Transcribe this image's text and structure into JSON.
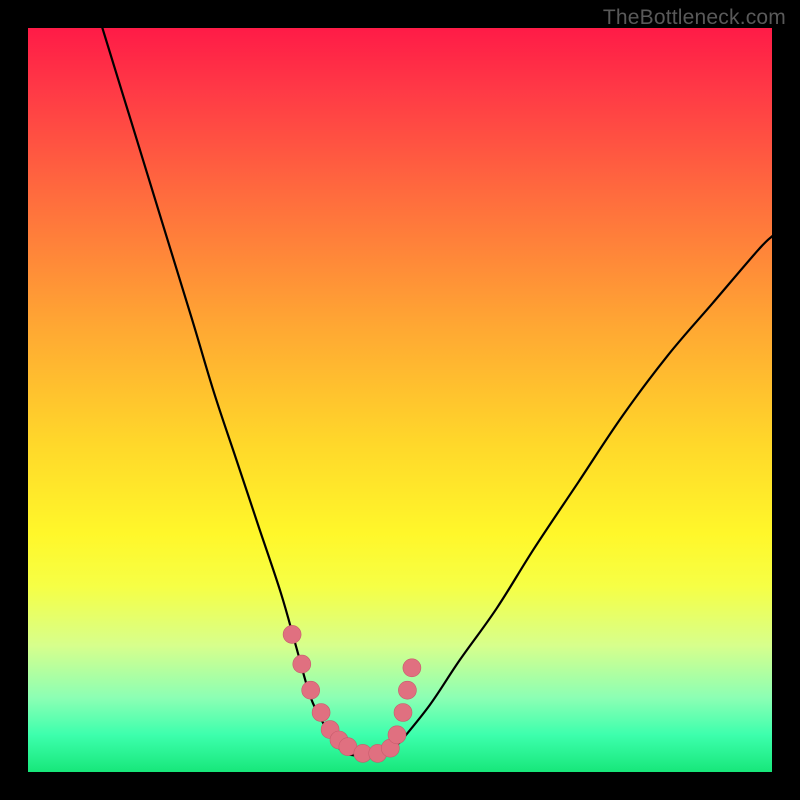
{
  "branding": "TheBottleneck.com",
  "colors": {
    "frame": "#000000",
    "gradient_top": "#ff1b47",
    "gradient_bottom": "#17e77a",
    "curve": "#000000",
    "marker": "#e07080"
  },
  "chart_data": {
    "type": "line",
    "title": "",
    "xlabel": "",
    "ylabel": "",
    "xlim": [
      0,
      100
    ],
    "ylim": [
      0,
      100
    ],
    "grid": false,
    "notes": "Bottleneck-style V-curve; no axis ticks or labels are rendered in the image. Values below are read off the visible shape on a 0–100 normalized plot coordinate system.",
    "series": [
      {
        "name": "left-branch",
        "x": [
          10,
          14,
          18,
          22,
          25,
          28,
          31,
          34,
          36,
          38,
          40
        ],
        "values": [
          100,
          87,
          74,
          61,
          51,
          42,
          33,
          24,
          17,
          10,
          6
        ]
      },
      {
        "name": "valley",
        "x": [
          40,
          42,
          44,
          46,
          48,
          50
        ],
        "values": [
          6,
          3,
          2.2,
          2.2,
          2.6,
          4
        ]
      },
      {
        "name": "right-branch",
        "x": [
          50,
          54,
          58,
          63,
          68,
          74,
          80,
          86,
          92,
          98,
          100
        ],
        "values": [
          4,
          9,
          15,
          22,
          30,
          39,
          48,
          56,
          63,
          70,
          72
        ]
      }
    ],
    "markers": {
      "name": "highlighted-points",
      "x": [
        35.5,
        36.8,
        38.0,
        39.4,
        40.6,
        41.8,
        43.0,
        45.0,
        47.0,
        48.7,
        49.6,
        50.4,
        51.0,
        51.6
      ],
      "values": [
        18.5,
        14.5,
        11.0,
        8.0,
        5.7,
        4.3,
        3.4,
        2.5,
        2.5,
        3.2,
        5.0,
        8.0,
        11.0,
        14.0
      ],
      "radius": 9
    }
  }
}
